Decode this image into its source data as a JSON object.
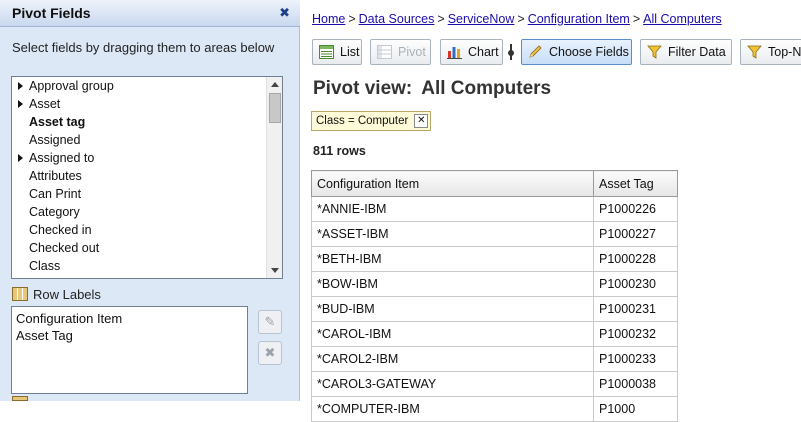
{
  "panel": {
    "title": "Pivot Fields",
    "close_icon": "close-icon",
    "instructions": "Select fields by dragging them to areas below",
    "fields": [
      {
        "label": "Approval group",
        "expandable": true,
        "bold": false
      },
      {
        "label": "Asset",
        "expandable": true,
        "bold": false
      },
      {
        "label": "Asset tag",
        "expandable": false,
        "bold": true
      },
      {
        "label": "Assigned",
        "expandable": false,
        "bold": false
      },
      {
        "label": "Assigned to",
        "expandable": true,
        "bold": false
      },
      {
        "label": "Attributes",
        "expandable": false,
        "bold": false
      },
      {
        "label": "Can Print",
        "expandable": false,
        "bold": false
      },
      {
        "label": "Category",
        "expandable": false,
        "bold": false
      },
      {
        "label": "Checked in",
        "expandable": false,
        "bold": false
      },
      {
        "label": "Checked out",
        "expandable": false,
        "bold": false
      },
      {
        "label": "Class",
        "expandable": false,
        "bold": false
      }
    ],
    "row_labels": {
      "title": "Row Labels",
      "items": [
        "Configuration Item",
        "Asset Tag"
      ]
    }
  },
  "breadcrumb": [
    "Home",
    "Data Sources",
    "ServiceNow",
    "Configuration Item",
    "All Computers"
  ],
  "breadcrumb_separator": ">",
  "toolbar": {
    "list": "List",
    "pivot": "Pivot",
    "chart": "Chart",
    "choose_fields": "Choose Fields",
    "filter_data": "Filter Data",
    "top_n": "Top-N"
  },
  "view": {
    "title_prefix": "Pivot view:",
    "title_name": "All Computers",
    "filter_chip": "Class = Computer",
    "row_count": "811 rows"
  },
  "table": {
    "columns": [
      "Configuration Item",
      "Asset Tag"
    ],
    "rows": [
      [
        "*ANNIE-IBM",
        "P1000226"
      ],
      [
        "*ASSET-IBM",
        "P1000227"
      ],
      [
        "*BETH-IBM",
        "P1000228"
      ],
      [
        "*BOW-IBM",
        "P1000230"
      ],
      [
        "*BUD-IBM",
        "P1000231"
      ],
      [
        "*CAROL-IBM",
        "P1000232"
      ],
      [
        "*CAROL2-IBM",
        "P1000233"
      ],
      [
        "*CAROL3-GATEWAY",
        "P1000038"
      ],
      [
        "*COMPUTER-IBM",
        "P1000"
      ]
    ]
  },
  "colors": {
    "panel_bg": "#dde8f6",
    "link": "#1a0dab",
    "active_button": "#c7def7",
    "chip_bg": "#fffbd8"
  }
}
